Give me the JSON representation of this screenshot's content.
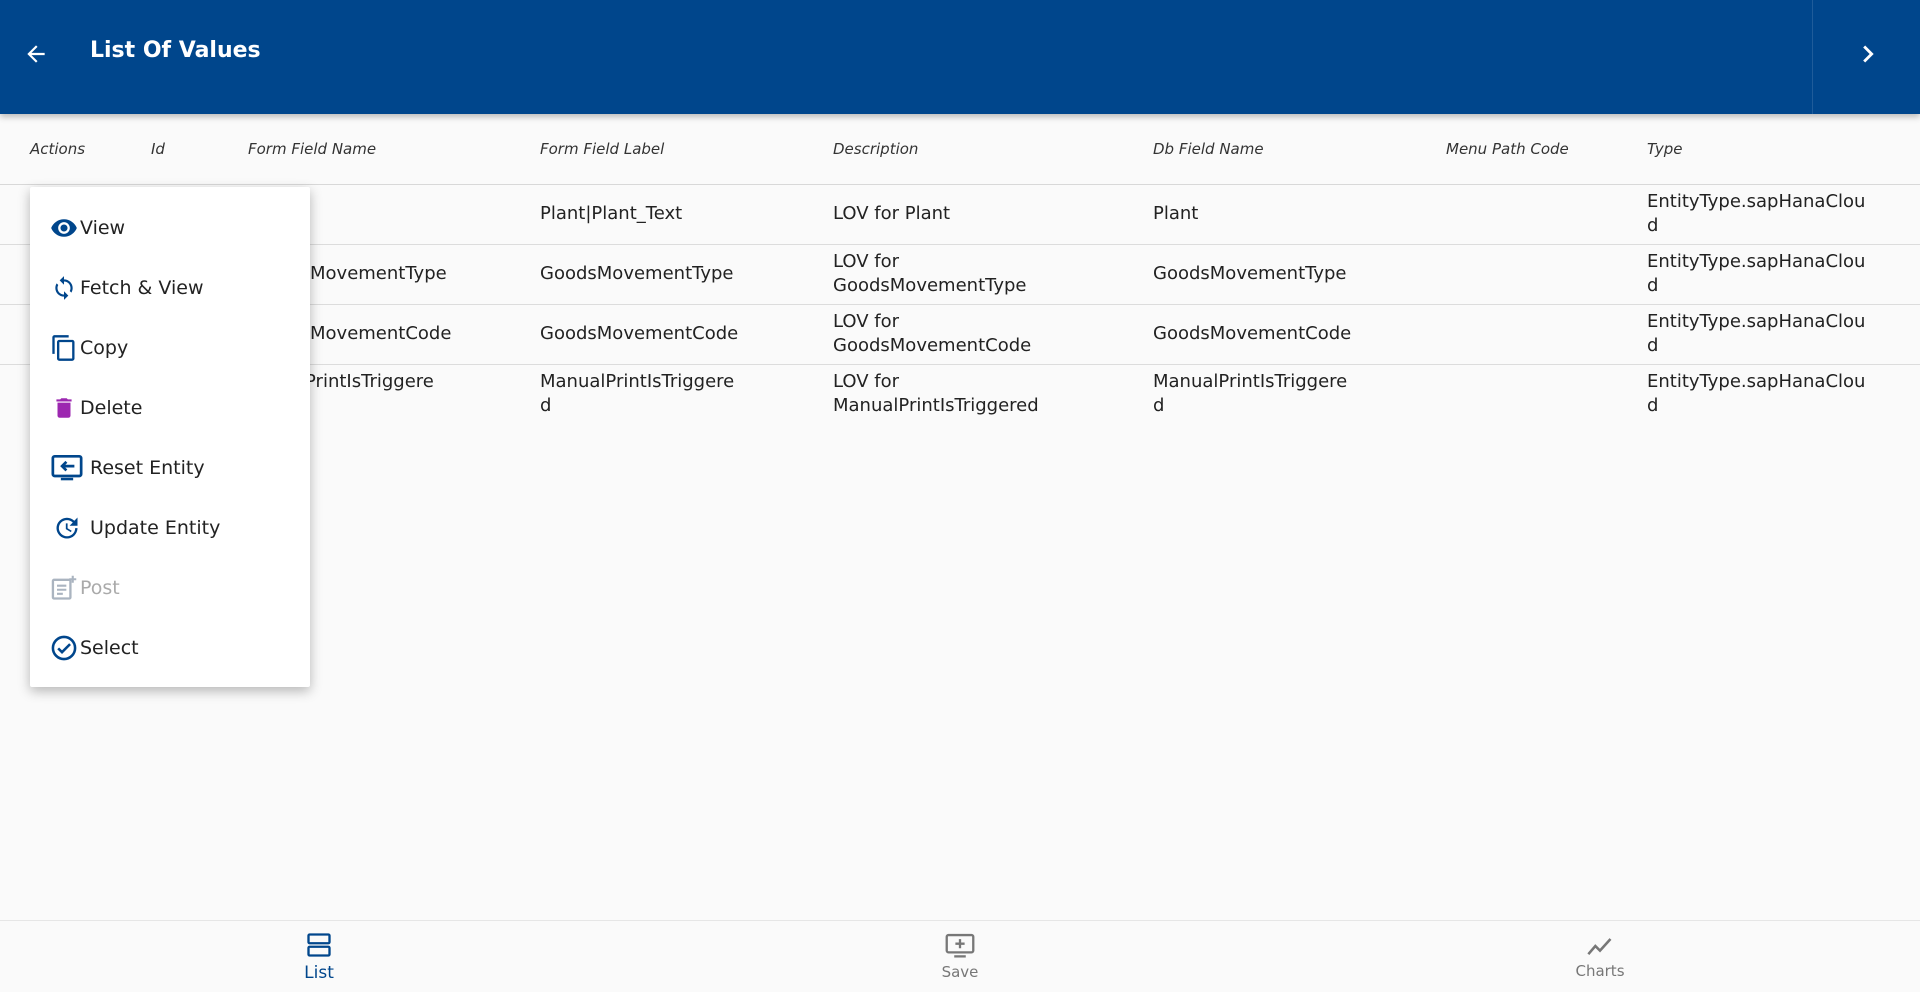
{
  "header": {
    "title": "List Of Values"
  },
  "table": {
    "columns": [
      "Actions",
      "Id",
      "Form Field Name",
      "Form Field Label",
      "Description",
      "Db Field Name",
      "Menu Path Code",
      "Type"
    ],
    "rows": [
      {
        "form_field_name": "",
        "form_field_label": [
          "Plant|Plant_Text"
        ],
        "description": [
          "LOV for Plant"
        ],
        "db_field_name": [
          "Plant"
        ],
        "menu_path_code": "",
        "type": [
          "EntityType.sapHanaClou",
          "d"
        ]
      },
      {
        "form_field_name": "MovementType",
        "form_field_label": [
          "GoodsMovementType"
        ],
        "description": [
          "LOV for",
          "GoodsMovementType"
        ],
        "db_field_name": [
          "GoodsMovementType"
        ],
        "menu_path_code": "",
        "type": [
          "EntityType.sapHanaClou",
          "d"
        ]
      },
      {
        "form_field_name": "MovementCode",
        "form_field_label": [
          "GoodsMovementCode"
        ],
        "description": [
          "LOV for",
          "GoodsMovementCode"
        ],
        "db_field_name": [
          "GoodsMovementCode"
        ],
        "menu_path_code": "",
        "type": [
          "EntityType.sapHanaClou",
          "d"
        ]
      },
      {
        "form_field_name": "lPrintIsTriggere",
        "form_field_label": [
          "ManualPrintIsTriggere",
          "d"
        ],
        "description": [
          "LOV for",
          "ManualPrintIsTriggered"
        ],
        "db_field_name": [
          "ManualPrintIsTriggere",
          "d"
        ],
        "menu_path_code": "",
        "type": [
          "EntityType.sapHanaClou",
          "d"
        ]
      }
    ]
  },
  "menu": {
    "items": [
      {
        "label": "View",
        "icon": "eye-icon",
        "disabled": false
      },
      {
        "label": "Fetch & View",
        "icon": "refresh-icon",
        "disabled": false
      },
      {
        "label": "Copy",
        "icon": "copy-icon",
        "disabled": false
      },
      {
        "label": "Delete",
        "icon": "trash-icon",
        "disabled": false
      },
      {
        "label": "Reset Entity",
        "icon": "reset-entity-icon",
        "disabled": false
      },
      {
        "label": "Update Entity",
        "icon": "update-entity-icon",
        "disabled": false
      },
      {
        "label": "Post",
        "icon": "post-icon",
        "disabled": true
      },
      {
        "label": "Select",
        "icon": "check-circle-icon",
        "disabled": false
      }
    ]
  },
  "bottom_nav": {
    "items": [
      {
        "label": "List",
        "icon": "list-icon",
        "active": true
      },
      {
        "label": "Save",
        "icon": "save-icon",
        "active": false
      },
      {
        "label": "Charts",
        "icon": "chart-icon",
        "active": false
      }
    ]
  },
  "colors": {
    "primary": "#00468c",
    "delete_accent": "#9c27b0",
    "disabled": "#aab4c0",
    "background": "#fafafa"
  }
}
